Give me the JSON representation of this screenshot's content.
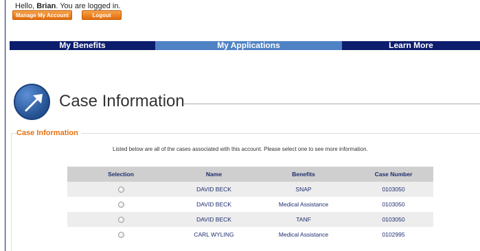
{
  "header": {
    "greeting_prefix": "Hello, ",
    "user_name": "Brian",
    "greeting_suffix": ". You are logged in.",
    "manage_account_label": "Manage My Account",
    "logout_label": "Logout"
  },
  "nav": {
    "items": [
      {
        "label": "My Benefits"
      },
      {
        "label": "My Applications",
        "active": true
      },
      {
        "label": "Learn More"
      }
    ]
  },
  "page": {
    "title": "Case Information",
    "icon": "arrow-icon"
  },
  "section": {
    "legend": "Case Information",
    "intro": "Listed below are all of the cases associated with this account. Please select one to see more information."
  },
  "table": {
    "headers": [
      "Selection",
      "Name",
      "Benefits",
      "Case Number"
    ],
    "rows": [
      {
        "name": "DAVID BECK",
        "benefits": "SNAP",
        "case_number": "0103050"
      },
      {
        "name": "DAVID BECK",
        "benefits": "Medical Assistance",
        "case_number": "0103050"
      },
      {
        "name": "DAVID BECK",
        "benefits": "TANF",
        "case_number": "0103050"
      },
      {
        "name": "CARL WYLING",
        "benefits": "Medical Assistance",
        "case_number": "0102995"
      }
    ]
  },
  "colors": {
    "nav_bg": "#0c1d6d",
    "nav_active": "#4f82c4",
    "accent_orange": "#e8700f",
    "table_text": "#1d2d6e"
  }
}
